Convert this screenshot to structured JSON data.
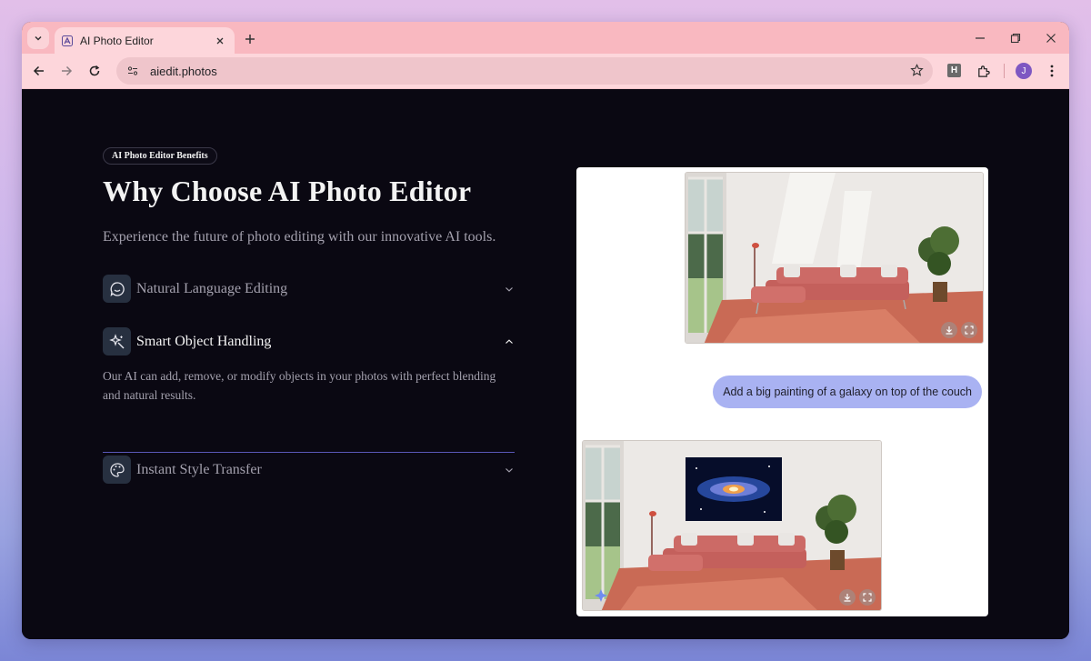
{
  "browser": {
    "tab_title": "AI Photo Editor",
    "url": "aiedit.photos",
    "ext_label": "H",
    "avatar_initial": "J"
  },
  "hero": {
    "badge": "AI Photo Editor Benefits",
    "title": "Why Choose AI Photo Editor",
    "subtitle": "Experience the future of photo editing with our innovative AI tools."
  },
  "features": [
    {
      "label": "Natural Language Editing",
      "icon": "chat-bubble-icon",
      "expanded": false
    },
    {
      "label": "Smart Object Handling",
      "icon": "magic-wand-icon",
      "expanded": true,
      "body": "Our AI can add, remove, or modify objects in your photos with perfect blending and natural results."
    },
    {
      "label": "Instant Style Transfer",
      "icon": "palette-icon",
      "expanded": false
    }
  ],
  "preview": {
    "prompt": "Add a big painting of a galaxy on top of the couch"
  },
  "colors": {
    "page_bg": "#0a0812",
    "tab_strip": "#f9b8c0",
    "toolbar": "#fdd6db",
    "accent": "#5a58b8",
    "bubble": "#a9b2f2"
  }
}
